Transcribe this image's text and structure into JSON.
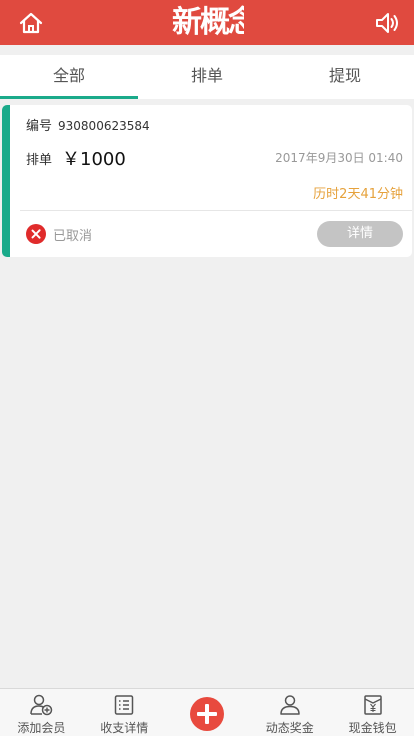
{
  "header": {
    "logo_text": "新概念",
    "accent_color": "#e04a3f"
  },
  "tabs": [
    {
      "label": "全部",
      "active": true
    },
    {
      "label": "排单",
      "active": false
    },
    {
      "label": "提现",
      "active": false
    }
  ],
  "order": {
    "serial_label": "编号",
    "serial_number": "930800623584",
    "type_label": "排单",
    "amount": "￥1000",
    "datetime": "2017年9月30日 01:40",
    "duration": "历时2天41分钟",
    "status": "已取消",
    "detail_button": "详情"
  },
  "bottom_nav": [
    {
      "label": "添加会员",
      "icon": "add-member-icon"
    },
    {
      "label": "收支详情",
      "icon": "list-icon"
    },
    {
      "label": "",
      "icon": "plus-icon"
    },
    {
      "label": "动态奖金",
      "icon": "members-icon"
    },
    {
      "label": "现金钱包",
      "icon": "wallet-icon"
    }
  ]
}
